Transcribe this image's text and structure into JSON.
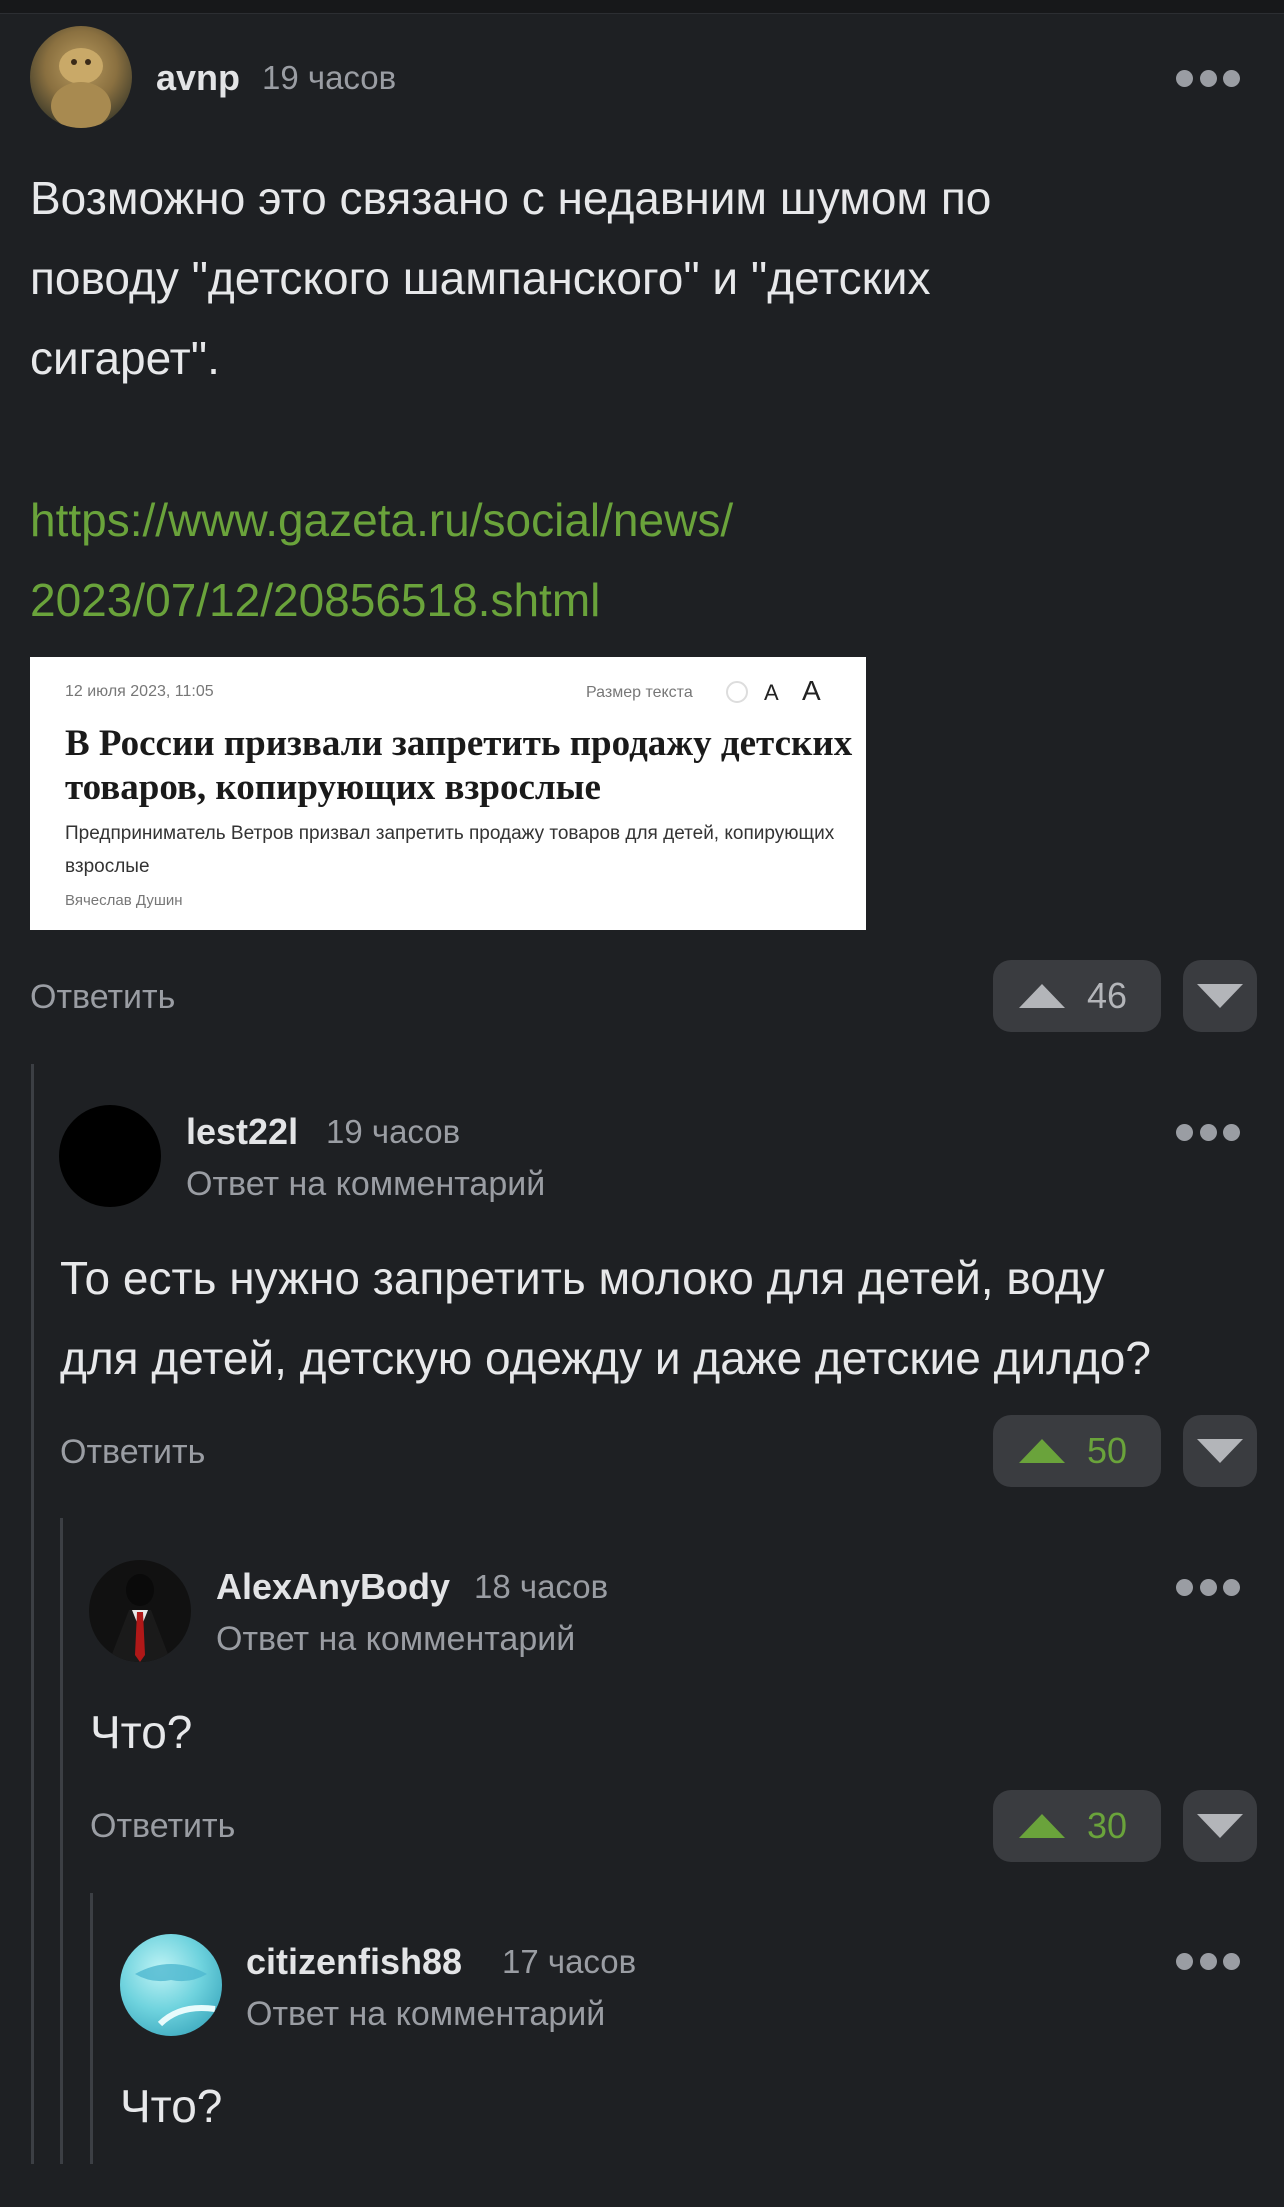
{
  "comments": [
    {
      "username": "avnp",
      "time": "19 часов",
      "text_lines": [
        "Возможно это связано с недавним шумом по",
        "поводу \"детского шампанского\" и \"детских",
        "сигарет\"."
      ],
      "link_lines": [
        "https://www.gazeta.ru/social/news/",
        "2023/07/12/20856518.shtml"
      ],
      "article": {
        "date": "12 июля 2023, 11:05",
        "text_size_label": "Размер текста",
        "font_small": "A",
        "font_large": "A",
        "title": "В России призвали запретить продажу детских товаров, копирующих взрослые",
        "subtitle": "Предприниматель Ветров призвал запретить продажу товаров для детей, копирующих взрослые",
        "author": "Вячеслав Душин"
      },
      "reply_label": "Ответить",
      "votes": "46",
      "upvoted": false
    },
    {
      "username": "lest22l",
      "time": "19 часов",
      "reply_to": "Ответ на комментарий",
      "text_lines": [
        "То есть нужно запретить молоко для детей, воду",
        "для детей, детскую одежду и даже детские дилдо?"
      ],
      "reply_label": "Ответить",
      "votes": "50",
      "upvoted": true
    },
    {
      "username": "AlexAnyBody",
      "time": "18 часов",
      "reply_to": "Ответ на комментарий",
      "text": "Что?",
      "reply_label": "Ответить",
      "votes": "30",
      "upvoted": true
    },
    {
      "username": "citizenfish88",
      "time": "17 часов",
      "reply_to": "Ответ на комментарий",
      "text": "Что?"
    }
  ],
  "icons": {
    "more": "more-dots-icon",
    "upvote": "upvote-triangle-icon",
    "downvote": "downvote-triangle-icon"
  },
  "colors": {
    "background": "#1e2023",
    "accent_green": "#6aa33b",
    "muted_text": "#9a9da3",
    "button_bg": "#3a3c40"
  }
}
